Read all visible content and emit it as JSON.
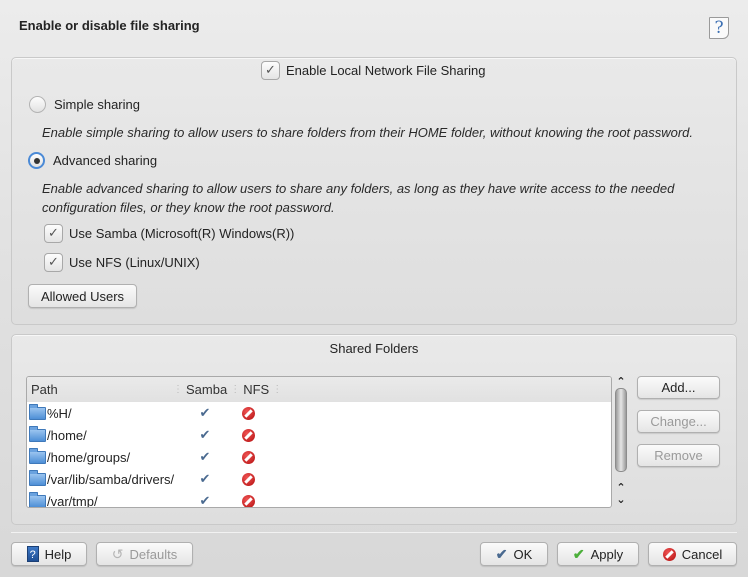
{
  "header": {
    "title": "Enable or disable file sharing",
    "help_icon": "help-question-icon"
  },
  "sharing": {
    "enable_local": {
      "label": "Enable Local Network File Sharing",
      "checked": true
    },
    "simple": {
      "label": "Simple sharing",
      "selected": false,
      "description": "Enable simple sharing to allow users to share folders from their HOME folder, without knowing the root password."
    },
    "advanced": {
      "label": "Advanced sharing",
      "selected": true,
      "description_line1": "Enable advanced sharing to allow users to share any folders, as long as they have write access to the needed",
      "description_line2": "configuration files, or they know the root password."
    },
    "use_samba": {
      "label": "Use Samba (Microsoft(R) Windows(R))",
      "checked": true
    },
    "use_nfs": {
      "label": "Use NFS (Linux/UNIX)",
      "checked": true
    },
    "allowed_users_label": "Allowed Users"
  },
  "shared_folders": {
    "title": "Shared Folders",
    "columns": [
      "Path",
      "Samba",
      "NFS"
    ],
    "rows": [
      {
        "path": "%H/",
        "samba": "enabled",
        "nfs": "disabled"
      },
      {
        "path": "/home/",
        "samba": "enabled",
        "nfs": "disabled"
      },
      {
        "path": "/home/groups/",
        "samba": "enabled",
        "nfs": "disabled"
      },
      {
        "path": "/var/lib/samba/drivers/",
        "samba": "enabled",
        "nfs": "disabled"
      },
      {
        "path": "/var/tmp/",
        "samba": "enabled",
        "nfs": "disabled"
      }
    ],
    "buttons": {
      "add": "Add...",
      "change": "Change...",
      "remove": "Remove"
    }
  },
  "footer": {
    "help": "Help",
    "defaults": "Defaults",
    "ok": "OK",
    "apply": "Apply",
    "cancel": "Cancel"
  },
  "colors": {
    "accent": "#4b8ad6",
    "check_blue": "#4a6a90",
    "apply_green": "#4caf3a",
    "cancel_red": "#c41a1a"
  }
}
